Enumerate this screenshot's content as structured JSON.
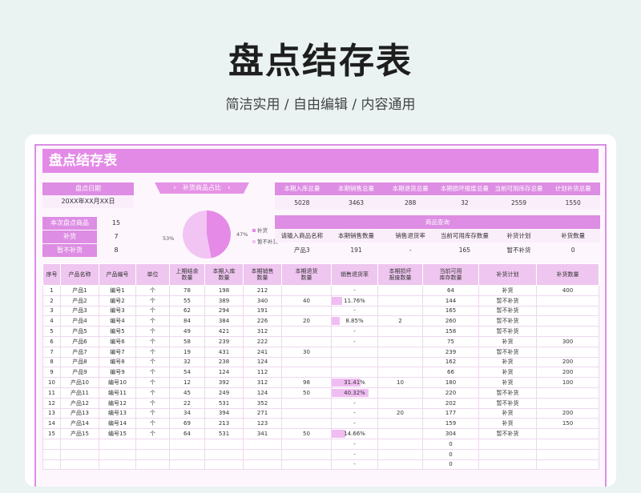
{
  "promo": {
    "title": "盘点结存表",
    "subtitle": "简洁实用 / 自由编辑 / 内容通用"
  },
  "sheet": {
    "title": "盘点结存表",
    "date_label": "盘点日期",
    "date_value": "20XX年XX月XX日",
    "stats": [
      {
        "label": "本次盘点商品",
        "value": "15"
      },
      {
        "label": "补货",
        "value": "7"
      },
      {
        "label": "暂不补货",
        "value": "8"
      }
    ],
    "pie": {
      "banner_label": "补货商品占比",
      "slices": [
        {
          "name": "补货",
          "pct": 47,
          "label": "47%",
          "color": "#e58ae6"
        },
        {
          "name": "暂不补货",
          "pct": 53,
          "label": "53%",
          "color": "#f2c4f3"
        }
      ]
    },
    "totals": {
      "headers": [
        "本期入库总量",
        "本期销售总量",
        "本期退货总量",
        "本期损坏报废总量",
        "当前可用库存总量",
        "计划补货总量"
      ],
      "values": [
        "5028",
        "3463",
        "288",
        "32",
        "2559",
        "1550"
      ]
    },
    "query": {
      "title": "商品查询",
      "headers": [
        "请输入商品名称",
        "本期销售数量",
        "销售退货率",
        "当前可用库存数量",
        "补货计划",
        "补货数量"
      ],
      "values": [
        "产品3",
        "191",
        "-",
        "165",
        "暂不补货",
        "0"
      ]
    },
    "table": {
      "headers": [
        "序号",
        "产品名称",
        "产品编号",
        "单位",
        "上期结余\n数量",
        "本期入库\n数量",
        "本期销售\n数量",
        "本期退货\n数量",
        "销售退货率",
        "本期损坏\n报废数量",
        "当前可用\n库存数量",
        "补货计划",
        "补货数量"
      ],
      "rows": [
        {
          "no": "1",
          "name": "产品1",
          "code": "编号1",
          "unit": "个",
          "prev": "78",
          "in": "198",
          "sold": "212",
          "ret": "",
          "rate": "-",
          "rate_frac": 0,
          "dmg": "",
          "stock": "64",
          "plan": "补货",
          "amt": "400"
        },
        {
          "no": "2",
          "name": "产品2",
          "code": "编号2",
          "unit": "个",
          "prev": "55",
          "in": "389",
          "sold": "340",
          "ret": "40",
          "rate": "11.76%",
          "rate_frac": 0.1176,
          "dmg": "",
          "stock": "144",
          "plan": "暂不补货",
          "amt": ""
        },
        {
          "no": "3",
          "name": "产品3",
          "code": "编号3",
          "unit": "个",
          "prev": "62",
          "in": "294",
          "sold": "191",
          "ret": "",
          "rate": "-",
          "rate_frac": 0,
          "dmg": "",
          "stock": "165",
          "plan": "暂不补货",
          "amt": ""
        },
        {
          "no": "4",
          "name": "产品4",
          "code": "编号4",
          "unit": "个",
          "prev": "84",
          "in": "384",
          "sold": "226",
          "ret": "20",
          "rate": "8.85%",
          "rate_frac": 0.0885,
          "dmg": "2",
          "stock": "260",
          "plan": "暂不补货",
          "amt": ""
        },
        {
          "no": "5",
          "name": "产品5",
          "code": "编号5",
          "unit": "个",
          "prev": "49",
          "in": "421",
          "sold": "312",
          "ret": "",
          "rate": "-",
          "rate_frac": 0,
          "dmg": "",
          "stock": "158",
          "plan": "暂不补货",
          "amt": ""
        },
        {
          "no": "6",
          "name": "产品6",
          "code": "编号6",
          "unit": "个",
          "prev": "58",
          "in": "239",
          "sold": "222",
          "ret": "",
          "rate": "-",
          "rate_frac": 0,
          "dmg": "",
          "stock": "75",
          "plan": "补货",
          "amt": "300"
        },
        {
          "no": "7",
          "name": "产品7",
          "code": "编号7",
          "unit": "个",
          "prev": "19",
          "in": "431",
          "sold": "241",
          "ret": "30",
          "rate": "",
          "rate_frac": 0,
          "dmg": "",
          "stock": "239",
          "plan": "暂不补货",
          "amt": ""
        },
        {
          "no": "8",
          "name": "产品8",
          "code": "编号8",
          "unit": "个",
          "prev": "32",
          "in": "238",
          "sold": "124",
          "ret": "",
          "rate": "",
          "rate_frac": 0,
          "dmg": "",
          "stock": "162",
          "plan": "补货",
          "amt": "200"
        },
        {
          "no": "9",
          "name": "产品9",
          "code": "编号9",
          "unit": "个",
          "prev": "54",
          "in": "124",
          "sold": "112",
          "ret": "",
          "rate": "",
          "rate_frac": 0,
          "dmg": "",
          "stock": "66",
          "plan": "补货",
          "amt": "200"
        },
        {
          "no": "10",
          "name": "产品10",
          "code": "编号10",
          "unit": "个",
          "prev": "12",
          "in": "392",
          "sold": "312",
          "ret": "98",
          "rate": "31.41%",
          "rate_frac": 0.3141,
          "dmg": "10",
          "stock": "180",
          "plan": "补货",
          "amt": "100"
        },
        {
          "no": "11",
          "name": "产品11",
          "code": "编号11",
          "unit": "个",
          "prev": "45",
          "in": "249",
          "sold": "124",
          "ret": "50",
          "rate": "40.32%",
          "rate_frac": 0.4032,
          "dmg": "",
          "stock": "220",
          "plan": "暂不补货",
          "amt": ""
        },
        {
          "no": "12",
          "name": "产品12",
          "code": "编号12",
          "unit": "个",
          "prev": "22",
          "in": "531",
          "sold": "352",
          "ret": "",
          "rate": "-",
          "rate_frac": 0,
          "dmg": "",
          "stock": "202",
          "plan": "暂不补货",
          "amt": ""
        },
        {
          "no": "13",
          "name": "产品13",
          "code": "编号13",
          "unit": "个",
          "prev": "34",
          "in": "394",
          "sold": "271",
          "ret": "",
          "rate": "-",
          "rate_frac": 0,
          "dmg": "20",
          "stock": "177",
          "plan": "补货",
          "amt": "200"
        },
        {
          "no": "14",
          "name": "产品14",
          "code": "编号14",
          "unit": "个",
          "prev": "69",
          "in": "213",
          "sold": "123",
          "ret": "",
          "rate": "-",
          "rate_frac": 0,
          "dmg": "",
          "stock": "159",
          "plan": "补货",
          "amt": "150"
        },
        {
          "no": "15",
          "name": "产品15",
          "code": "编号15",
          "unit": "个",
          "prev": "64",
          "in": "531",
          "sold": "341",
          "ret": "50",
          "rate": "14.66%",
          "rate_frac": 0.1466,
          "dmg": "",
          "stock": "304",
          "plan": "暂不补货",
          "amt": ""
        },
        {
          "no": "",
          "name": "",
          "code": "",
          "unit": "",
          "prev": "",
          "in": "",
          "sold": "",
          "ret": "",
          "rate": "-",
          "rate_frac": 0,
          "dmg": "",
          "stock": "0",
          "plan": "",
          "amt": ""
        },
        {
          "no": "",
          "name": "",
          "code": "",
          "unit": "",
          "prev": "",
          "in": "",
          "sold": "",
          "ret": "",
          "rate": "-",
          "rate_frac": 0,
          "dmg": "",
          "stock": "0",
          "plan": "",
          "amt": ""
        },
        {
          "no": "",
          "name": "",
          "code": "",
          "unit": "",
          "prev": "",
          "in": "",
          "sold": "",
          "ret": "",
          "rate": "-",
          "rate_frac": 0,
          "dmg": "",
          "stock": "0",
          "plan": "",
          "amt": ""
        }
      ]
    }
  }
}
